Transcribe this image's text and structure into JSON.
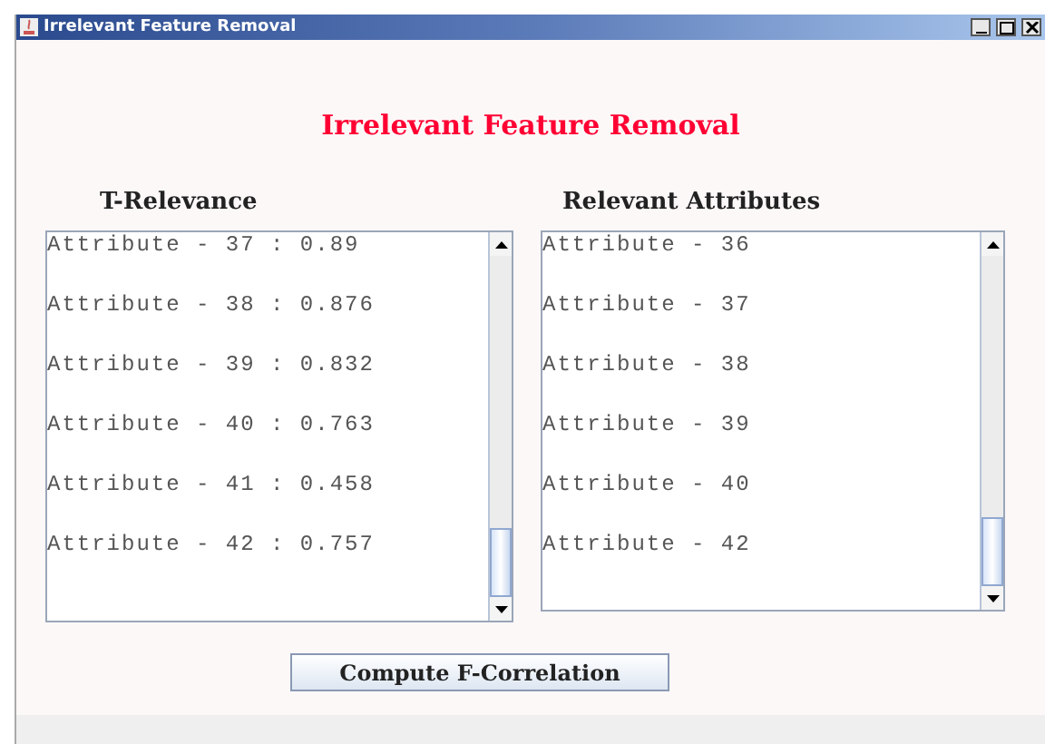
{
  "window": {
    "title": "Irrelevant Feature Removal"
  },
  "heading": "Irrelevant Feature Removal",
  "panels": [
    {
      "title": "T-Relevance",
      "items": [
        "Attribute - 37 : 0.89",
        "Attribute - 38 : 0.876",
        "Attribute - 39 : 0.832",
        "Attribute - 40 : 0.763",
        "Attribute - 41 : 0.458",
        "Attribute - 42 : 0.757"
      ]
    },
    {
      "title": "Relevant Attributes",
      "items": [
        "Attribute - 36",
        "Attribute - 37",
        "Attribute - 38",
        "Attribute - 39",
        "Attribute - 40",
        "Attribute - 42"
      ]
    }
  ],
  "button": "Compute F-Correlation"
}
